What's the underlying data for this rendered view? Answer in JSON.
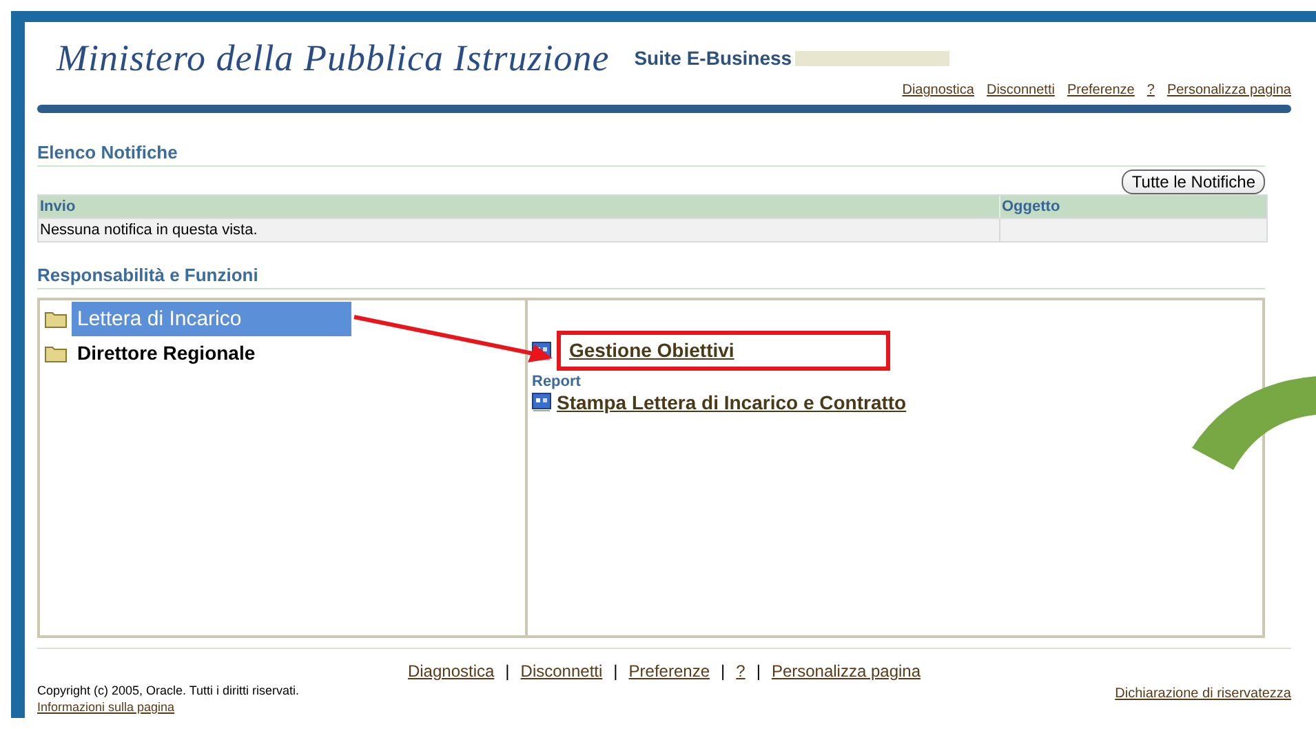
{
  "header": {
    "title": "Ministero della Pubblica Istruzione",
    "suite": "Suite E-Business",
    "links": [
      "Diagnostica",
      "Disconnetti",
      "Preferenze",
      "?",
      "Personalizza pagina"
    ]
  },
  "notifications": {
    "title": "Elenco Notifiche",
    "button": "Tutte le Notifiche",
    "columns": [
      "Invio",
      "Oggetto"
    ],
    "rows": [
      [
        "Nessuna notifica in questa vista.",
        ""
      ]
    ]
  },
  "responsibilities": {
    "title": "Responsabilità e Funzioni",
    "items": [
      {
        "label": "Lettera di Incarico",
        "selected": true
      },
      {
        "label": "Direttore Regionale",
        "selected": false
      }
    ],
    "functions": [
      {
        "kind": "link",
        "label": "Gestione Obiettivi",
        "highlighted": true
      },
      {
        "kind": "heading",
        "label": "Report"
      },
      {
        "kind": "link",
        "label": "Stampa Lettera di Incarico  e Contratto",
        "highlighted": false
      }
    ]
  },
  "footer": {
    "separator": "|",
    "links": [
      "Diagnostica",
      "Disconnetti",
      "Preferenze",
      "?",
      "Personalizza pagina"
    ],
    "copyright": "Copyright (c) 2005, Oracle. Tutti i diritti riservati.",
    "info_link": "Informazioni sulla pagina",
    "privacy_link": "Dichiarazione di riservatezza"
  }
}
